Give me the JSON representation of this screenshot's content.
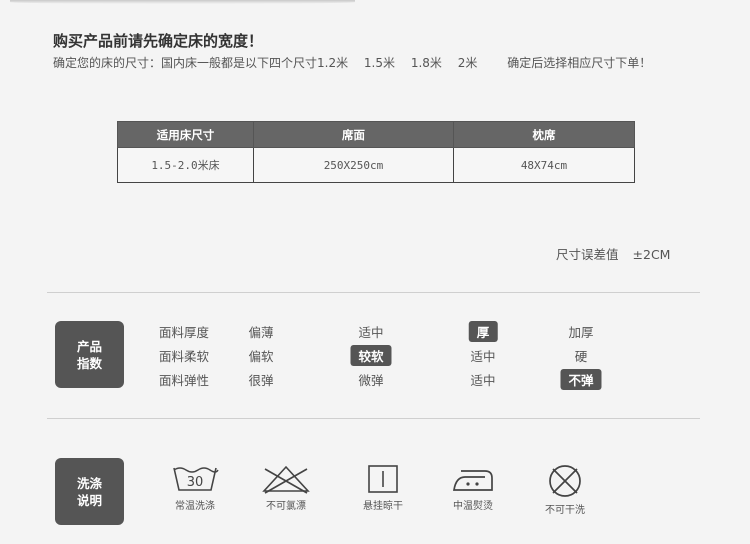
{
  "heading": "购买产品前请先确定床的宽度！",
  "subline": {
    "intro": "确定您的床的尺寸：国内床一般都是以下四个尺寸1.2米",
    "s2": "1.5米",
    "s3": "1.8米",
    "s4": "2米",
    "outro": "确定后选择相应尺寸下单！"
  },
  "size_table": {
    "headers": [
      "适用床尺寸",
      "席面",
      "枕席"
    ],
    "row": [
      "1.5-2.0米床",
      "250X250cm",
      "48X74cm"
    ]
  },
  "tolerance": {
    "label": "尺寸误差值",
    "value": "±2CM"
  },
  "product_index": {
    "badge": [
      "产品",
      "指数"
    ],
    "rows": [
      {
        "label": "面料厚度",
        "options": [
          "偏薄",
          "适中",
          "厚",
          "加厚"
        ],
        "selected": 2
      },
      {
        "label": "面料柔软",
        "options": [
          "偏软",
          "较软",
          "适中",
          "硬"
        ],
        "selected": 1
      },
      {
        "label": "面料弹性",
        "options": [
          "很弹",
          "微弹",
          "适中",
          "不弹"
        ],
        "selected": 3
      }
    ]
  },
  "wash": {
    "badge": [
      "洗涤",
      "说明"
    ],
    "items": [
      {
        "icon": "wash-30-icon",
        "tub_text": "30",
        "caption": "常温洗涤"
      },
      {
        "icon": "no-bleach-icon",
        "caption": "不可氯漂"
      },
      {
        "icon": "hang-dry-icon",
        "caption": "悬挂晾干"
      },
      {
        "icon": "iron-medium-icon",
        "caption": "中温熨烫"
      },
      {
        "icon": "no-dry-clean-icon",
        "caption": "不可干洗"
      }
    ]
  },
  "colors": {
    "dark": "#555555",
    "header": "#666666",
    "text": "#555555",
    "background": "#f4f4f4"
  }
}
